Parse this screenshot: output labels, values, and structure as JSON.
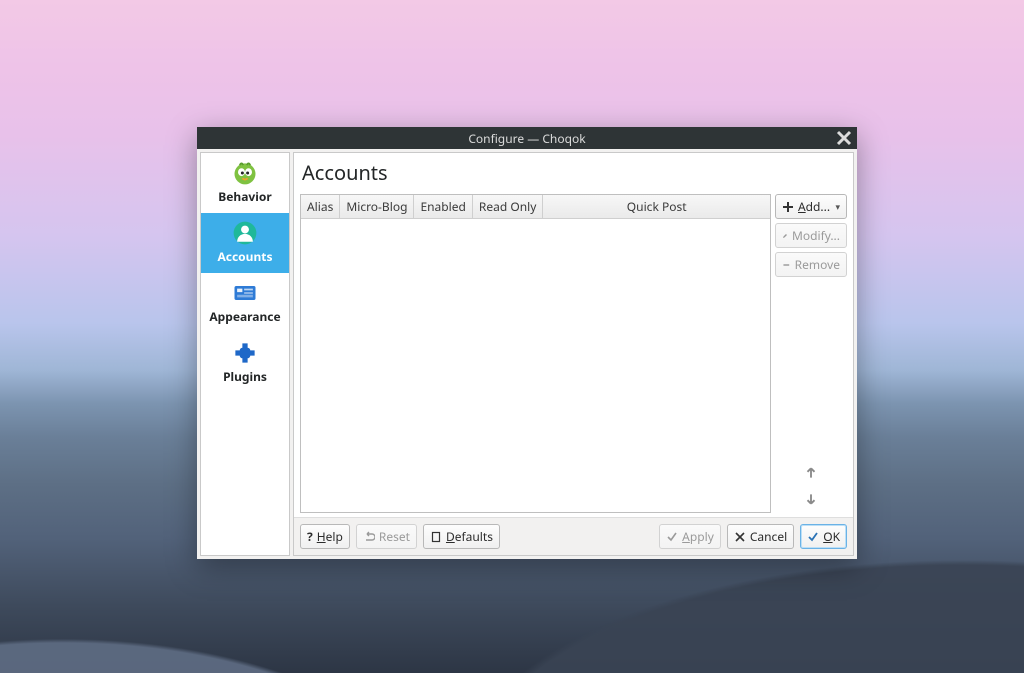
{
  "window": {
    "title": "Configure — Choqok"
  },
  "sidebar": {
    "items": [
      {
        "label": "Behavior"
      },
      {
        "label": "Accounts"
      },
      {
        "label": "Appearance"
      },
      {
        "label": "Plugins"
      }
    ]
  },
  "page": {
    "title": "Accounts",
    "columns": [
      "Alias",
      "Micro-Blog",
      "Enabled",
      "Read Only",
      "Quick Post"
    ]
  },
  "buttons": {
    "add": "Add...",
    "modify": "Modify...",
    "remove": "Remove",
    "help": "Help",
    "reset": "Reset",
    "defaults": "Defaults",
    "apply": "Apply",
    "cancel": "Cancel",
    "ok": "OK"
  }
}
